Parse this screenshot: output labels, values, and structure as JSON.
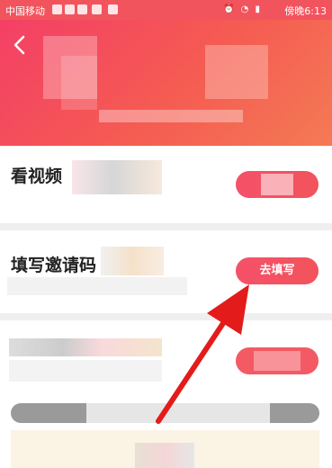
{
  "status_bar": {
    "carrier": "中国移动",
    "time": "傍晚6:13"
  },
  "tasks": [
    {
      "title": "看视频"
    },
    {
      "title": "填写邀请码",
      "button_label": "去填写"
    }
  ],
  "colors": {
    "accent": "#f5516a",
    "header_start": "#f43f66",
    "header_end": "#f47a55"
  }
}
